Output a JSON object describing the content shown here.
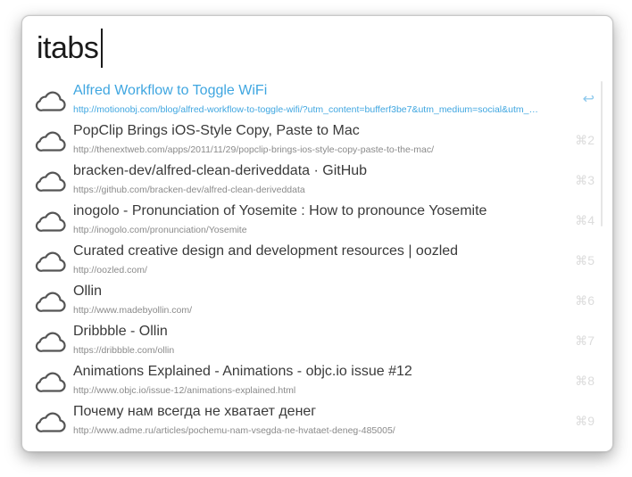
{
  "search": {
    "query": "itabs"
  },
  "results": [
    {
      "title": "Alfred Workflow to Toggle WiFi",
      "url": "http://motionobj.com/blog/alfred-workflow-to-toggle-wifi/?utm_content=bufferf3be7&utm_medium=social&utm_…",
      "shortcut": "↩",
      "icon": "cloud-icon",
      "selected": true
    },
    {
      "title": "PopClip Brings iOS-Style Copy, Paste to Mac",
      "url": "http://thenextweb.com/apps/2011/11/29/popclip-brings-ios-style-copy-paste-to-the-mac/",
      "shortcut": "⌘2",
      "icon": "cloud-icon"
    },
    {
      "title": "bracken-dev/alfred-clean-deriveddata · GitHub",
      "url": "https://github.com/bracken-dev/alfred-clean-deriveddata",
      "shortcut": "⌘3",
      "icon": "cloud-icon"
    },
    {
      "title": "inogolo - Pronunciation of Yosemite : How to pronounce Yosemite",
      "url": "http://inogolo.com/pronunciation/Yosemite",
      "shortcut": "⌘4",
      "icon": "cloud-icon"
    },
    {
      "title": "Curated creative design and development resources | oozled",
      "url": "http://oozled.com/",
      "shortcut": "⌘5",
      "icon": "cloud-icon"
    },
    {
      "title": "Ollin",
      "url": "http://www.madebyollin.com/",
      "shortcut": "⌘6",
      "icon": "cloud-icon"
    },
    {
      "title": "Dribbble - Ollin",
      "url": "https://dribbble.com/ollin",
      "shortcut": "⌘7",
      "icon": "cloud-icon"
    },
    {
      "title": "Animations Explained - Animations - objc.io issue #12",
      "url": "http://www.objc.io/issue-12/animations-explained.html",
      "shortcut": "⌘8",
      "icon": "cloud-icon"
    },
    {
      "title": "Почему нам всегда не хватает денег",
      "url": "http://www.adme.ru/articles/pochemu-nam-vsegda-ne-hvataet-deneg-485005/",
      "shortcut": "⌘9",
      "icon": "cloud-icon"
    }
  ],
  "colors": {
    "accent": "#3fa6e0",
    "title_text": "#3a3a3a",
    "url_text": "#8a8a8a",
    "shortcut_text": "#dcdcdc",
    "icon_stroke": "#555555"
  }
}
